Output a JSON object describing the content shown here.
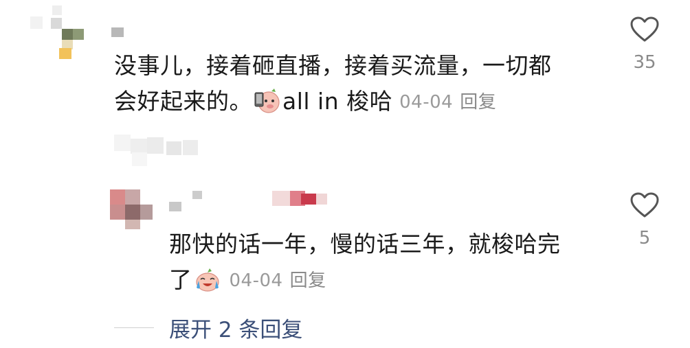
{
  "comments": [
    {
      "text_line1": "没事儿，接着砸直播，接着买流量，一切都",
      "text_line2": "会好起来的。",
      "emoji_name": "phone-pig-emoji",
      "text_after_emoji": "all in 梭哈",
      "date": "04-04",
      "reply_label": "回复",
      "likes": "35"
    },
    {
      "text_line1": "那快的话一年，慢的话三年，就梭哈完",
      "text_line2": "了",
      "emoji_name": "crying-laughing-emoji",
      "date": "04-04",
      "reply_label": "回复",
      "likes": "5"
    }
  ],
  "expand_replies": "展开 2 条回复",
  "colors": {
    "text": "#1a1a1a",
    "meta": "#9a9a9a",
    "link": "#3b4f78",
    "heart": "#555555"
  }
}
